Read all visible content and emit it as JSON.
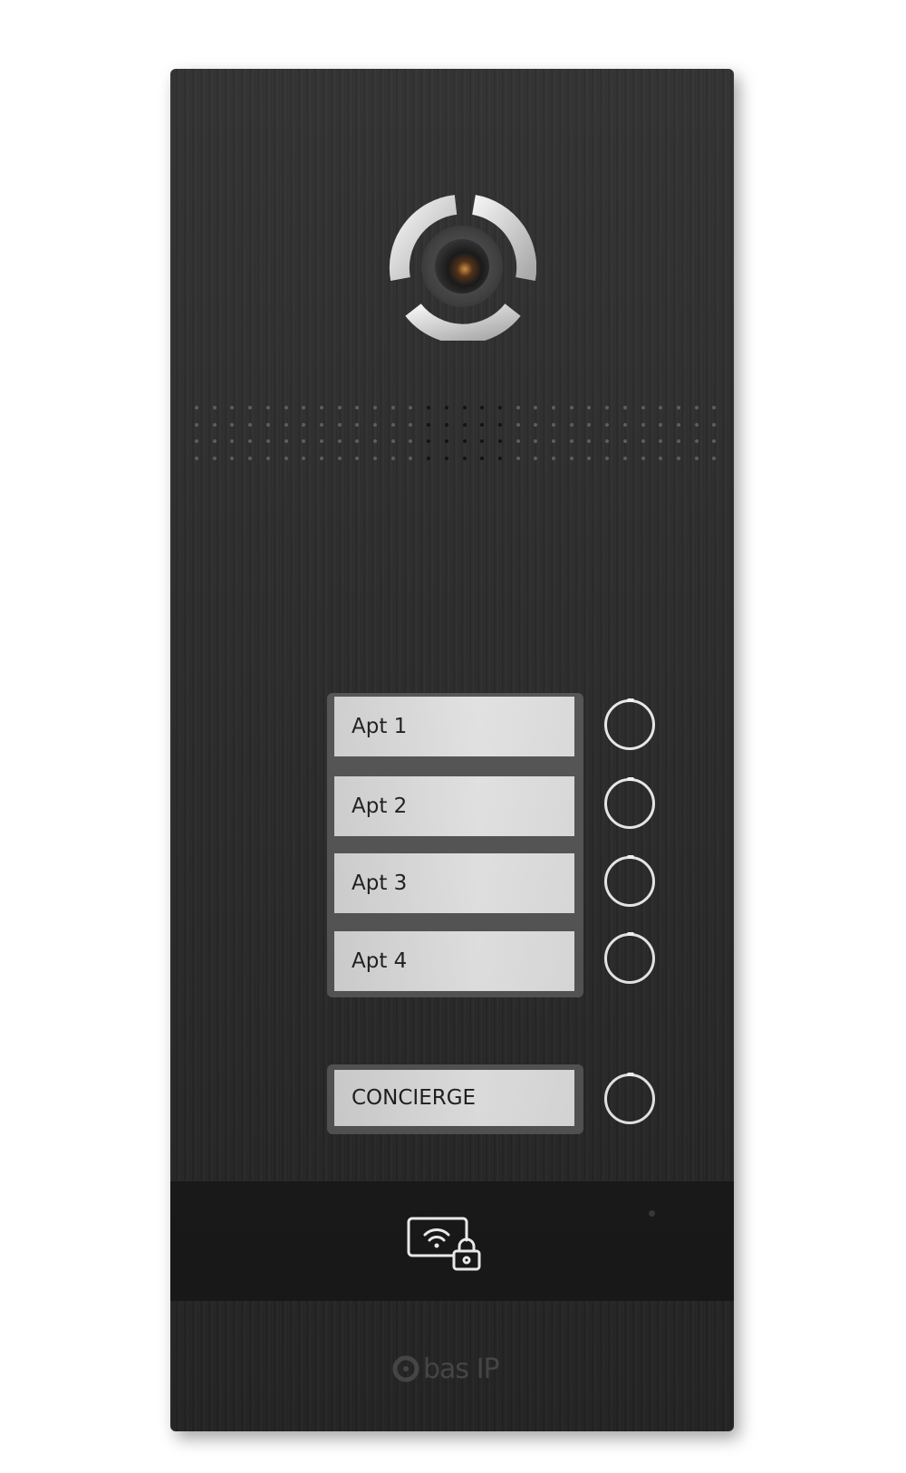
{
  "device": {
    "labels": [
      "Apt 1",
      "Apt 2",
      "Apt 3",
      "Apt 4"
    ],
    "concierge": "CONCIERGE",
    "logo_text": "bas IP",
    "icons": {
      "camera": "camera-lens-icon",
      "reader": "card-reader-lock-icon"
    },
    "colors": {
      "panel": "#2a2a2a",
      "band": "#191919",
      "label": "#e8e8e8",
      "button_ring": "#f2f2f2"
    }
  }
}
